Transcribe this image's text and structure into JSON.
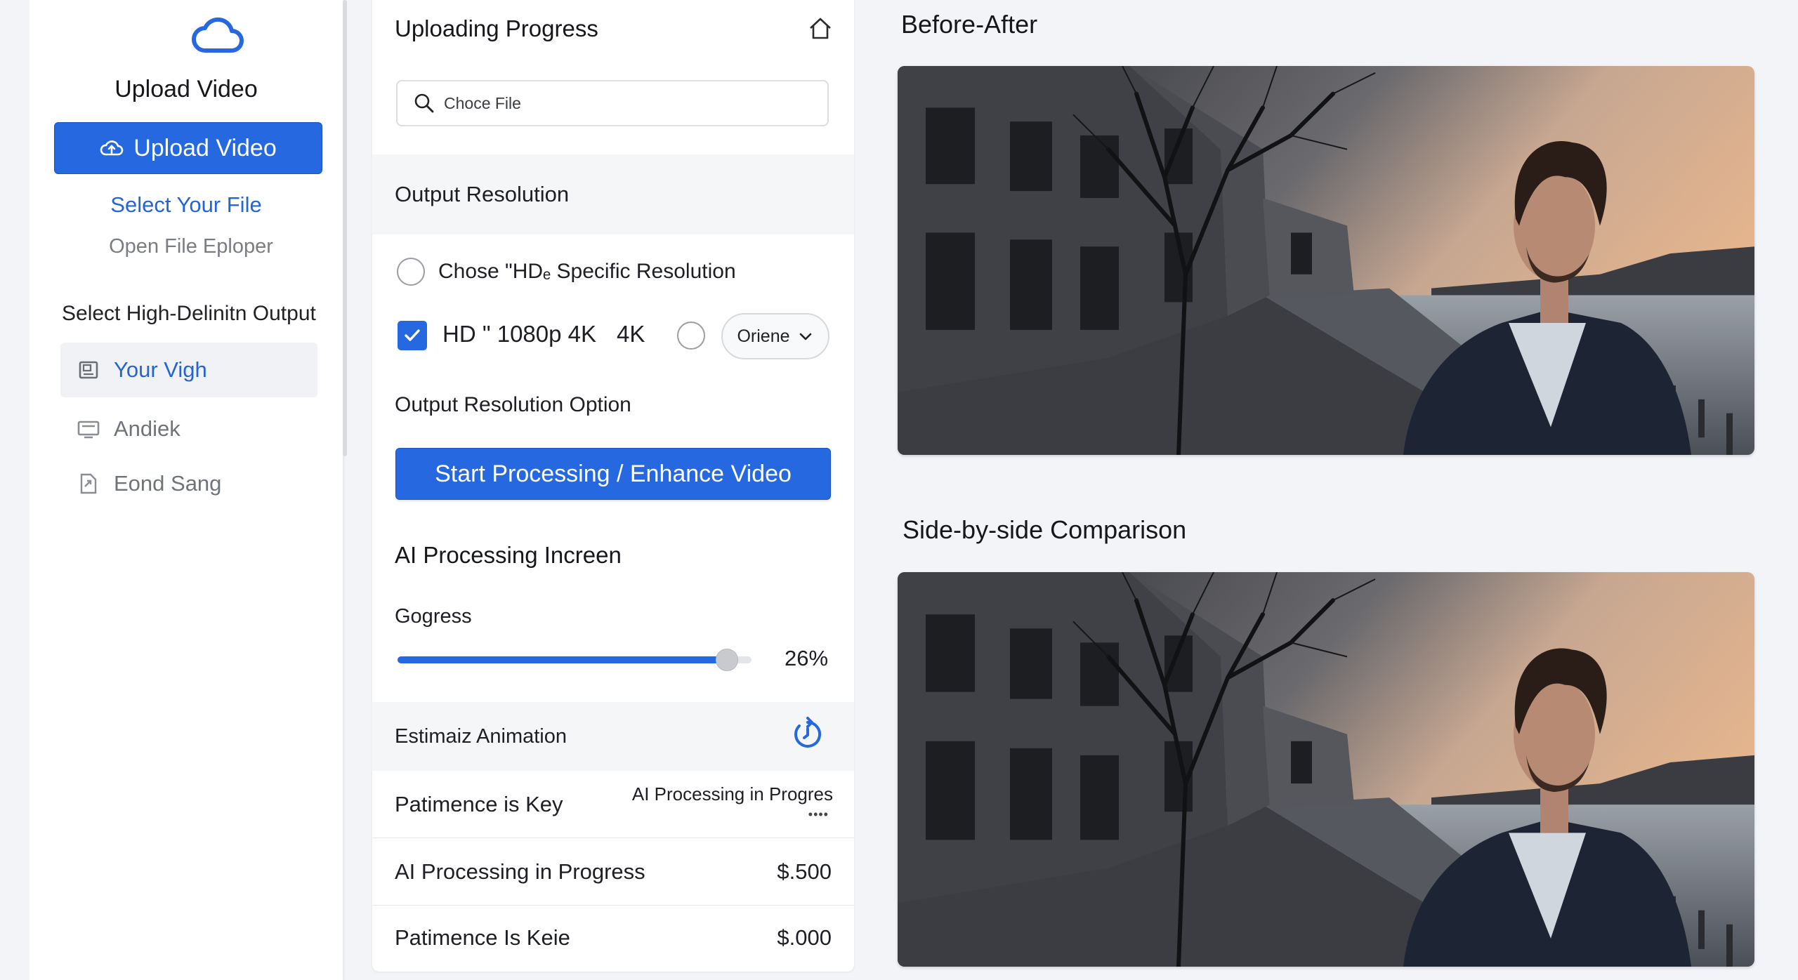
{
  "sidebar": {
    "app_title": "Upload Video",
    "upload_button_label": "Upload Video",
    "select_file_link": "Select Your File",
    "open_explorer_link": "Open File Eploper",
    "section_label": "Select High-Delinitn Output",
    "items": [
      {
        "label": "Your Vigh",
        "icon": "gallery-icon",
        "active": true
      },
      {
        "label": "Andiek",
        "icon": "monitor-icon",
        "active": false
      },
      {
        "label": "Eond Sang",
        "icon": "file-export-icon",
        "active": false
      }
    ]
  },
  "panel": {
    "title": "Uploading Progress",
    "search_placeholder": "Choce File",
    "output_resolution_heading": "Output Resolution",
    "radio_option_label": "Chose \"HDₑ Specific Resolution",
    "resolution_hd_label": "HD \" 1080p 4K",
    "resolution_4k_label": "4K",
    "dropdown_selected": "Oriene",
    "resolution_option_label": "Output Resolution Option",
    "start_button_label": "Start Processing / Enhance Video",
    "ai_heading": "AI Processing Increen",
    "progress_label": "Gogress",
    "progress_percent": 26,
    "progress_text": "26%",
    "estimate_label": "Estimaiz Animation",
    "rows": [
      {
        "label": "Patimence is Key",
        "note": "AI Processing in Progres",
        "note_dots": "••••"
      },
      {
        "label": "AI Processing in Progress",
        "value": "$.500"
      },
      {
        "label": "Patimence Is Keie",
        "value": "$.000"
      }
    ]
  },
  "content": {
    "before_after_heading": "Before-After",
    "comparison_heading": "Side-by-side Comparison"
  },
  "colors": {
    "accent": "#2568e0",
    "link": "#2265d9",
    "background": "#f3f4f7"
  }
}
